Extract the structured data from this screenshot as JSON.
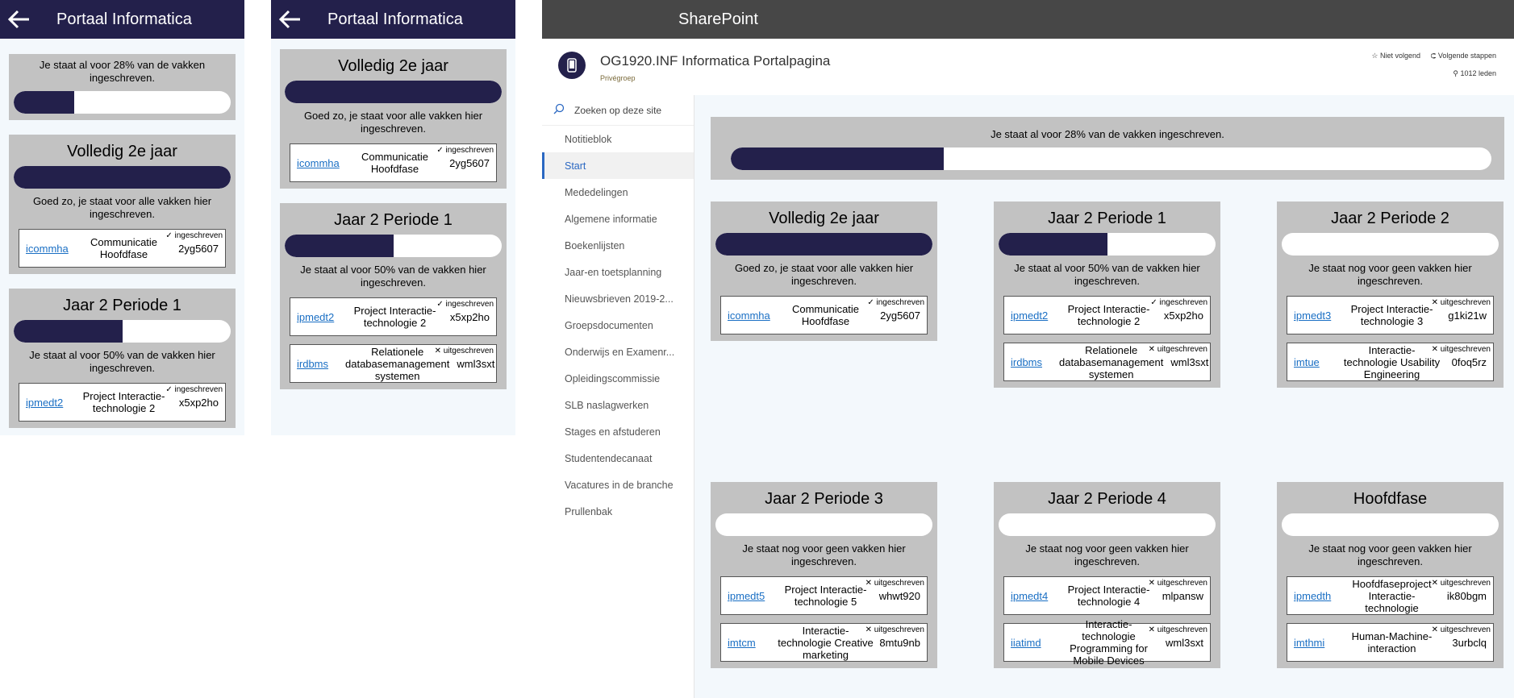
{
  "colors": {
    "accent": "#23204b",
    "card_bg": "#c2c2c2",
    "link": "#1a6fc4",
    "sp_topbar": "#474747",
    "nav_active": "#2b68c2"
  },
  "phone1": {
    "title": "Portaal Informatica",
    "overall": {
      "text": "Je staat al voor 28% van de vakken ingeschreven.",
      "progress": 0.28
    },
    "cards": [
      {
        "title": "Volledig 2e jaar",
        "progress": 1.0,
        "message": "Goed zo, je staat voor alle vakken hier ingeschreven.",
        "courses": [
          {
            "code": "icommha",
            "name": "Communicatie Hoofdfase",
            "id": "2yg5607",
            "status": "✓ ingeschreven"
          }
        ]
      },
      {
        "title": "Jaar 2 Periode 1",
        "progress": 0.5,
        "message": "Je staat al voor 50% van de vakken hier ingeschreven.",
        "courses": [
          {
            "code": "ipmedt2",
            "name": "Project Interactie-technologie 2",
            "id": "x5xp2ho",
            "status": "✓ ingeschreven"
          }
        ]
      }
    ]
  },
  "phone2": {
    "title": "Portaal Informatica",
    "cards": [
      {
        "title": "Volledig 2e jaar",
        "progress": 1.0,
        "message": "Goed zo, je staat voor alle vakken hier ingeschreven.",
        "courses": [
          {
            "code": "icommha",
            "name": "Communicatie Hoofdfase",
            "id": "2yg5607",
            "status": "✓ ingeschreven"
          }
        ]
      },
      {
        "title": "Jaar 2 Periode 1",
        "progress": 0.5,
        "message": "Je staat al voor 50% van de vakken hier ingeschreven.",
        "courses": [
          {
            "code": "ipmedt2",
            "name": "Project Interactie-technologie 2",
            "id": "x5xp2ho",
            "status": "✓ ingeschreven"
          },
          {
            "code": "irdbms",
            "name": "Relationele databasemanagement systemen",
            "id": "wml3sxt",
            "status": "✕ uitgeschreven"
          }
        ]
      }
    ]
  },
  "sharepoint": {
    "app_name": "SharePoint",
    "site_title": "OG1920.INF Informatica Portalpagina",
    "site_type": "Privégroep",
    "follow": "☆ Niet volgend",
    "next_steps": "Volgende stappen",
    "members": "1012 leden",
    "search_placeholder": "Zoeken op deze site",
    "nav": [
      "Notitieblok",
      "Start",
      "Mededelingen",
      "Algemene informatie",
      "Boekenlijsten",
      "Jaar-en toetsplanning",
      "Nieuwsbrieven 2019-2...",
      "Groepsdocumenten",
      "Onderwijs en Examenr...",
      "Opleidingscommissie",
      "SLB naslagwerken",
      "Stages en afstuderen",
      "Studentendecanaat",
      "Vacatures in de branche",
      "Prullenbak"
    ],
    "overall": {
      "text": "Je staat al voor 28% van de vakken ingeschreven.",
      "progress": 0.28
    },
    "cards": [
      {
        "title": "Volledig 2e jaar",
        "progress": 1.0,
        "message": "Goed zo, je staat voor alle vakken hier ingeschreven.",
        "courses": [
          {
            "code": "icommha",
            "name": "Communicatie Hoofdfase",
            "id": "2yg5607",
            "status": "✓ ingeschreven"
          }
        ]
      },
      {
        "title": "Jaar 2 Periode 1",
        "progress": 0.5,
        "message": "Je staat al voor 50% van de vakken hier ingeschreven.",
        "courses": [
          {
            "code": "ipmedt2",
            "name": "Project Interactie-technologie 2",
            "id": "x5xp2ho",
            "status": "✓ ingeschreven"
          },
          {
            "code": "irdbms",
            "name": "Relationele databasemanagement systemen",
            "id": "wml3sxt",
            "status": "✕ uitgeschreven"
          }
        ]
      },
      {
        "title": "Jaar 2 Periode 2",
        "progress": 0,
        "message": "Je staat nog voor geen vakken hier ingeschreven.",
        "courses": [
          {
            "code": "ipmedt3",
            "name": "Project Interactie-technologie 3",
            "id": "g1ki21w",
            "status": "✕ uitgeschreven"
          },
          {
            "code": "imtue",
            "name": "Interactie-technologie Usability Engineering",
            "id": "0foq5rz",
            "status": "✕ uitgeschreven"
          }
        ]
      },
      {
        "title": "Jaar 2 Periode 3",
        "progress": 0,
        "message": "Je staat nog voor geen vakken hier ingeschreven.",
        "courses": [
          {
            "code": "ipmedt5",
            "name": "Project Interactie-technologie 5",
            "id": "whwt920",
            "status": "✕ uitgeschreven"
          },
          {
            "code": "imtcm",
            "name": "Interactie-technologie Creative marketing",
            "id": "8mtu9nb",
            "status": "✕ uitgeschreven"
          }
        ]
      },
      {
        "title": "Jaar 2 Periode 4",
        "progress": 0,
        "message": "Je staat nog voor geen vakken hier ingeschreven.",
        "courses": [
          {
            "code": "ipmedt4",
            "name": "Project Interactie-technologie 4",
            "id": "mlpansw",
            "status": "✕ uitgeschreven"
          },
          {
            "code": "iiatimd",
            "name": "Interactie-technologie Programming for Mobile Devices",
            "id": "wml3sxt",
            "status": "✕ uitgeschreven"
          }
        ]
      },
      {
        "title": "Hoofdfase",
        "progress": 0,
        "message": "Je staat nog voor geen vakken hier ingeschreven.",
        "courses": [
          {
            "code": "ipmedth",
            "name": "Hoofdfaseproject Interactie-technologie",
            "id": "ik80bgm",
            "status": "✕ uitgeschreven"
          },
          {
            "code": "imthmi",
            "name": "Human-Machine-interaction",
            "id": "3urbclq",
            "status": "✕ uitgeschreven"
          }
        ]
      }
    ]
  }
}
